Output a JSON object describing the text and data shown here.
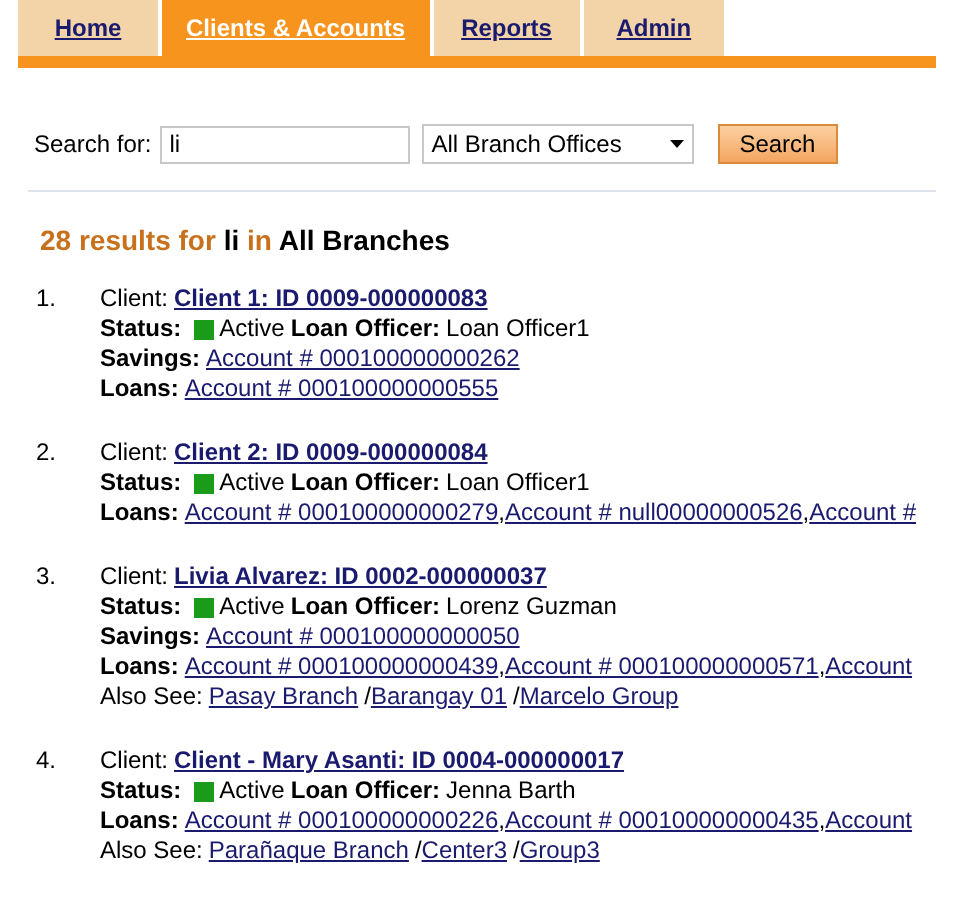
{
  "tabs": [
    {
      "label": "Home",
      "selected": false
    },
    {
      "label": "Clients & Accounts",
      "selected": true
    },
    {
      "label": "Reports",
      "selected": false
    },
    {
      "label": "Admin",
      "selected": false
    }
  ],
  "search": {
    "label": "Search for:",
    "value": "li",
    "branch": "All Branch Offices",
    "button": "Search"
  },
  "account_separator": ",",
  "link_separator": "/",
  "summary": {
    "count_text": "28 results for",
    "term": "li",
    "in_text": "in",
    "scope": "All Branches"
  },
  "results": [
    {
      "number": "1.",
      "client_label": "Client:",
      "client": "Client 1: ID 0009-000000083",
      "status_label": "Status:",
      "status": "Active",
      "officer_label": "Loan Officer:",
      "officer": "Loan Officer1",
      "accounts": [
        {
          "label": "Savings:",
          "links": [
            "Account # 000100000000262"
          ]
        },
        {
          "label": "Loans:",
          "links": [
            "Account # 000100000000555"
          ]
        }
      ]
    },
    {
      "number": "2.",
      "client_label": "Client:",
      "client": "Client 2: ID 0009-000000084",
      "status_label": "Status:",
      "status": "Active",
      "officer_label": "Loan Officer:",
      "officer": "Loan Officer1",
      "accounts": [
        {
          "label": "Loans:",
          "links": [
            "Account # 000100000000279",
            "Account # null00000000526",
            "Account #"
          ]
        }
      ]
    },
    {
      "number": "3.",
      "client_label": "Client:",
      "client": "Livia Alvarez: ID 0002-000000037",
      "status_label": "Status:",
      "status": "Active",
      "officer_label": "Loan Officer:",
      "officer": "Lorenz Guzman",
      "accounts": [
        {
          "label": "Savings:",
          "links": [
            "Account # 000100000000050"
          ]
        },
        {
          "label": "Loans:",
          "links": [
            "Account # 000100000000439",
            "Account # 000100000000571",
            "Account"
          ]
        }
      ],
      "also_label": "Also See:",
      "also": [
        "Pasay Branch",
        "Barangay 01",
        "Marcelo Group"
      ]
    },
    {
      "number": "4.",
      "client_label": "Client:",
      "client": "Client - Mary Asanti: ID 0004-000000017",
      "status_label": "Status:",
      "status": "Active",
      "officer_label": "Loan Officer:",
      "officer": "Jenna Barth",
      "accounts": [
        {
          "label": "Loans:",
          "links": [
            "Account # 000100000000226",
            "Account # 000100000000435",
            "Account"
          ]
        }
      ],
      "also_label": "Also See:",
      "also": [
        "Parañaque Branch",
        "Center3",
        "Group3"
      ]
    }
  ]
}
